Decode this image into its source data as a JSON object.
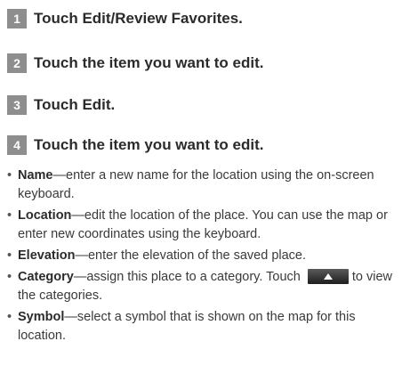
{
  "steps": [
    {
      "number": "1",
      "text": "Touch Edit/Review Favorites."
    },
    {
      "number": "2",
      "text": "Touch the item you want to edit."
    },
    {
      "number": "3",
      "text": "Touch Edit."
    },
    {
      "number": "4",
      "text": "Touch the item you want to edit."
    }
  ],
  "bullets": [
    {
      "term": "Name",
      "text": "—enter a new name for the location using the on-screen keyboard."
    },
    {
      "term": "Location",
      "text": "—edit the location of the place. You can use the map or enter new coordinates using the keyboard."
    },
    {
      "term": "Elevation",
      "text": "—enter the elevation of the saved place."
    },
    {
      "term": "Category",
      "text": "—assign this place to a category. Touch",
      "after_button": "to view the categories.",
      "button_icon": "up-arrow-icon"
    },
    {
      "term": "Symbol",
      "text": "—select a symbol that is shown on the map for this location."
    }
  ],
  "bullet_char": "•",
  "colors": {
    "step_badge": "#8e8e8e",
    "text": "#2b2b2b",
    "button": "#1e1e1e"
  }
}
